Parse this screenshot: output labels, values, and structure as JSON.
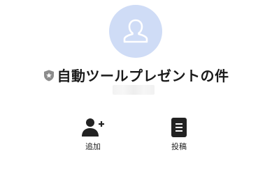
{
  "profile": {
    "name": "自動ツールプレゼントの件",
    "badge_icon": "shield-star-icon",
    "avatar_icon": "default-user-icon",
    "avatar_color": "#cfdcf6"
  },
  "actions": [
    {
      "label": "追加",
      "icon": "add-person-icon"
    },
    {
      "label": "投稿",
      "icon": "post-document-icon"
    }
  ]
}
